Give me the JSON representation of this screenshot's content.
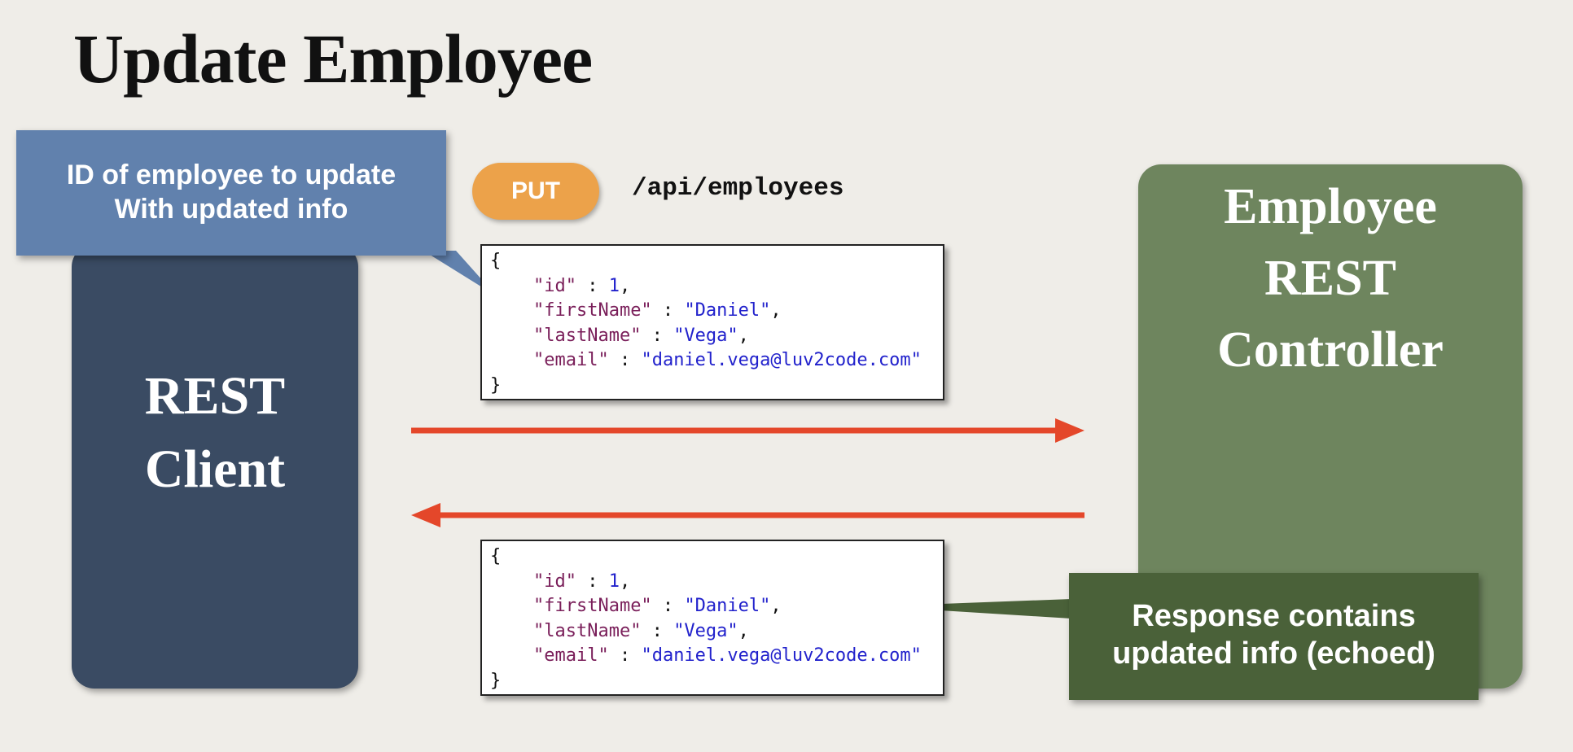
{
  "page": {
    "title": "Update Employee"
  },
  "client": {
    "label_line1": "REST",
    "label_line2": "Client",
    "color": "#3a4b63"
  },
  "controller": {
    "label_line1": "Employee",
    "label_line2": "REST",
    "label_line3": "Controller",
    "color": "#6e855e"
  },
  "request_callout": {
    "line1": "ID of employee to update",
    "line2": "With updated info",
    "color": "#6181ad"
  },
  "request": {
    "method": "PUT",
    "method_color": "#eca24a",
    "endpoint": "/api/employees"
  },
  "request_body": {
    "open": "{",
    "close": "}",
    "fields": [
      {
        "key": "\"id\"",
        "sep": " : ",
        "value": "1",
        "trail": ","
      },
      {
        "key": "\"firstName\"",
        "sep": " : ",
        "value": "\"Daniel\"",
        "trail": ","
      },
      {
        "key": "\"lastName\"",
        "sep": " : ",
        "value": "\"Vega\"",
        "trail": ","
      },
      {
        "key": "\"email\"",
        "sep": " : ",
        "value": "\"daniel.vega@luv2code.com\"",
        "trail": ""
      }
    ]
  },
  "response_body": {
    "open": "{",
    "close": "}",
    "fields": [
      {
        "key": "\"id\"",
        "sep": " : ",
        "value": "1",
        "trail": ","
      },
      {
        "key": "\"firstName\"",
        "sep": " : ",
        "value": "\"Daniel\"",
        "trail": ","
      },
      {
        "key": "\"lastName\"",
        "sep": " : ",
        "value": "\"Vega\"",
        "trail": ","
      },
      {
        "key": "\"email\"",
        "sep": " : ",
        "value": "\"daniel.vega@luv2code.com\"",
        "trail": ""
      }
    ]
  },
  "response_callout": {
    "line1": "Response contains",
    "line2": "updated info (echoed)",
    "color": "#4a6139"
  },
  "arrows": {
    "color": "#e4472a"
  }
}
